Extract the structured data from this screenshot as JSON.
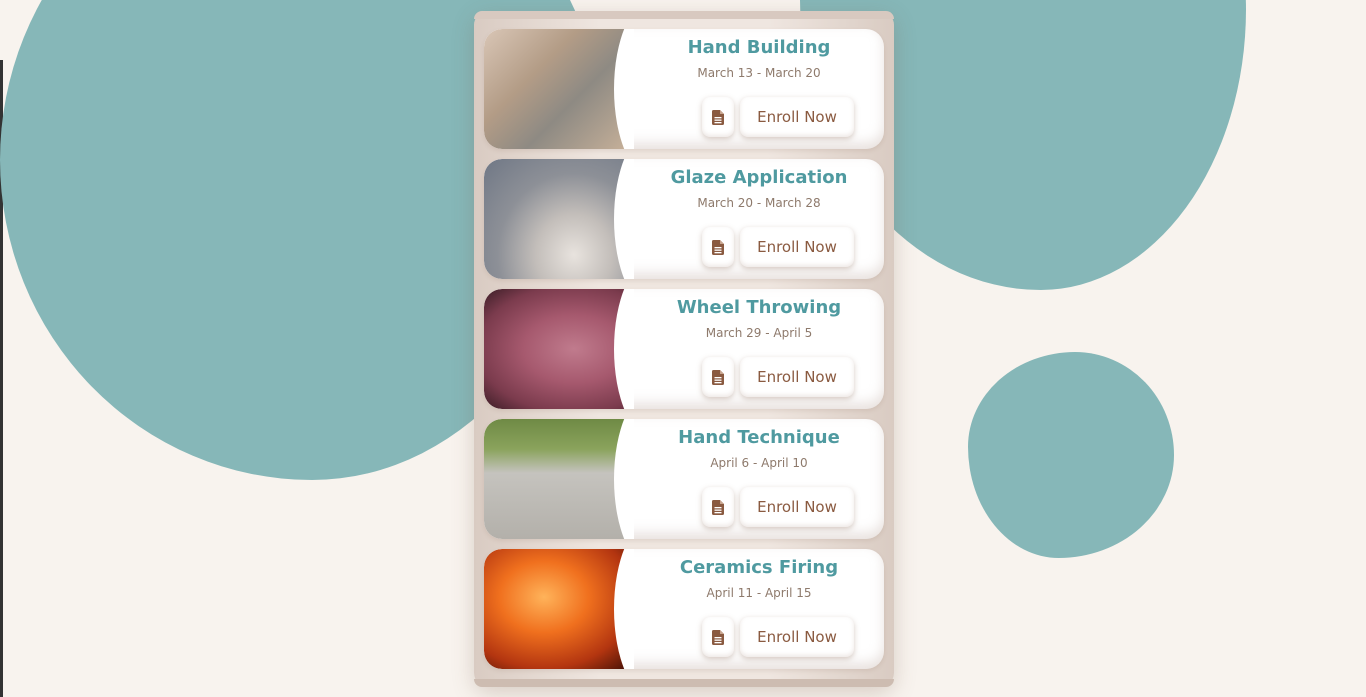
{
  "colors": {
    "background": "#f8f3ee",
    "blob": "#86b7b8",
    "title": "#4f9aa0",
    "dates": "#8e7a6c",
    "button_text": "#8a5a40",
    "icon": "#8a5a40"
  },
  "courses": [
    {
      "title": "Hand Building",
      "dates": "March 13 - March 20",
      "enroll_label": "Enroll Now",
      "doc_icon": "file-text-icon",
      "image": "hands-shaping-clay"
    },
    {
      "title": "Glaze Application",
      "dates": "March 20 - March 28",
      "enroll_label": "Enroll Now",
      "doc_icon": "file-text-icon",
      "image": "pottery-wheel-bowl"
    },
    {
      "title": "Wheel Throwing",
      "dates": "March 29 - April 5",
      "enroll_label": "Enroll Now",
      "doc_icon": "file-text-icon",
      "image": "hands-throwing-vase"
    },
    {
      "title": "Hand Technique",
      "dates": "April 6 - April 10",
      "enroll_label": "Enroll Now",
      "doc_icon": "file-text-icon",
      "image": "owl-planter-with-rosemary"
    },
    {
      "title": "Ceramics Firing",
      "dates": "April 11 - April 15",
      "enroll_label": "Enroll Now",
      "doc_icon": "file-text-icon",
      "image": "glowing-kiln-lantern"
    }
  ]
}
